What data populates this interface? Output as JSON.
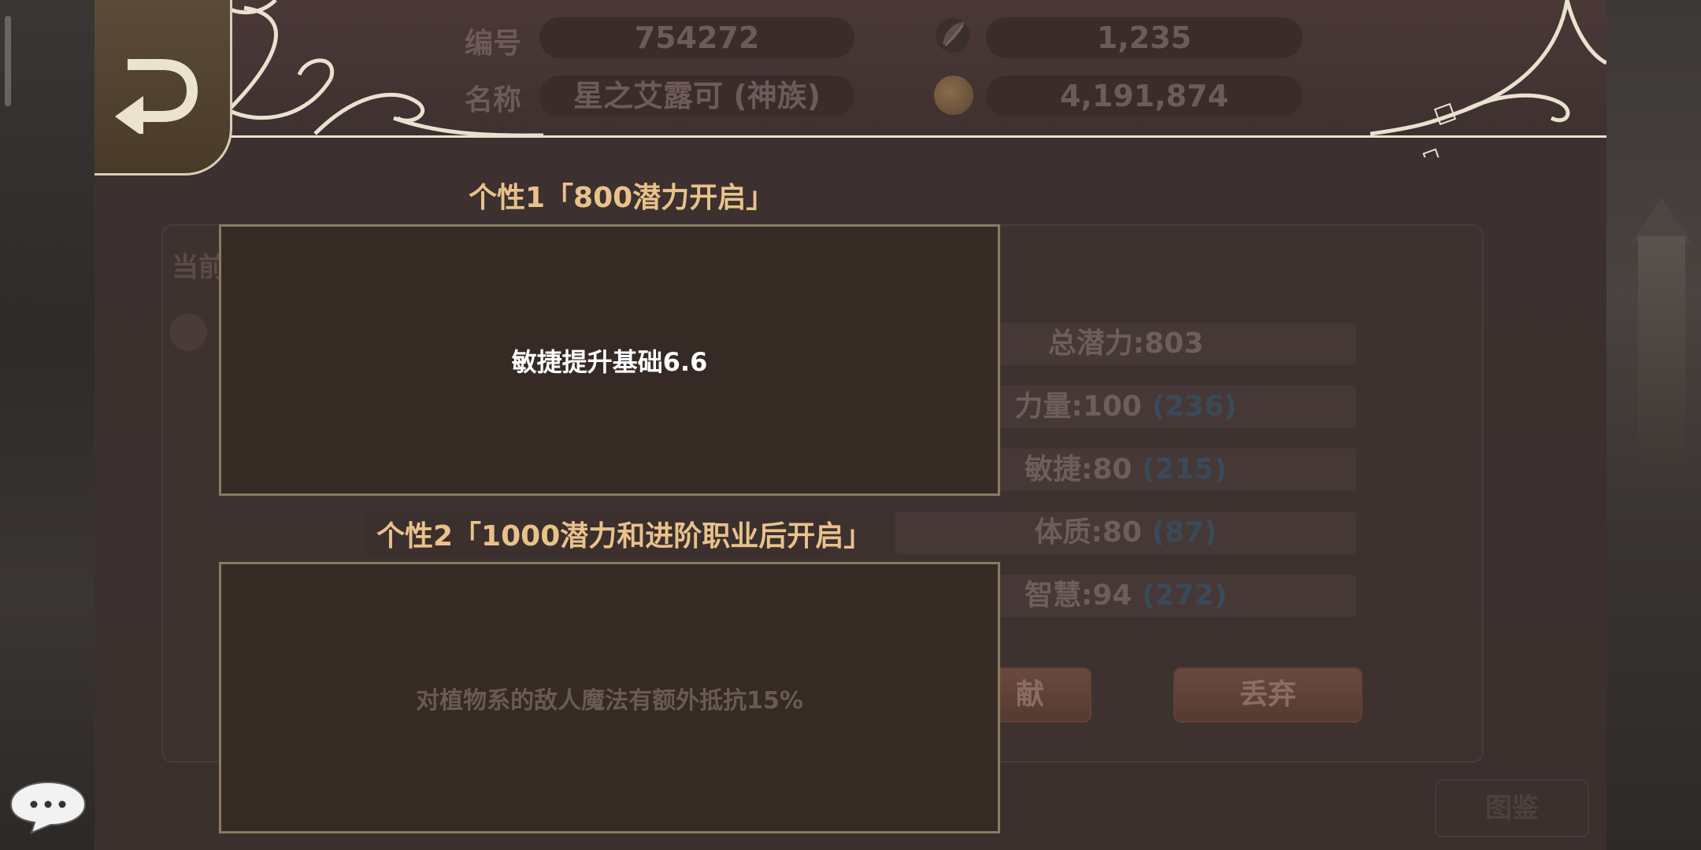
{
  "header": {
    "id_label": "编号",
    "id_value": "754272",
    "name_label": "名称",
    "name_value": "星之艾露可 (神族)",
    "currency1_icon": "feather-medal-icon",
    "currency1_value": "1,235",
    "currency2_icon": "gold-coin-icon",
    "currency2_value": "4,191,874"
  },
  "background_panel": {
    "current_label": "当前",
    "stats": [
      {
        "label": "总潜力:803",
        "bonus": ""
      },
      {
        "label": "力量:100",
        "bonus": "(236)"
      },
      {
        "label": "敏捷:80",
        "bonus": "(215)"
      },
      {
        "label": "体质:80",
        "bonus": "(87)"
      },
      {
        "label": "智慧:94",
        "bonus": "(272)"
      }
    ],
    "contribute_label": "献",
    "discard_label": "丢弃",
    "gallery_label": "图鉴"
  },
  "traits": [
    {
      "title": "个性1「800潜力开启」",
      "description": "敏捷提升基础6.6",
      "active": true
    },
    {
      "title": "个性2「1000潜力和进阶职业后开启」",
      "description": "对植物系的敌人魔法有额外抵抗15%",
      "active": false
    }
  ],
  "colors": {
    "title_gold": "#e9c28b",
    "panel_border": "#8b7a62",
    "header_line": "#e9e2cf"
  }
}
